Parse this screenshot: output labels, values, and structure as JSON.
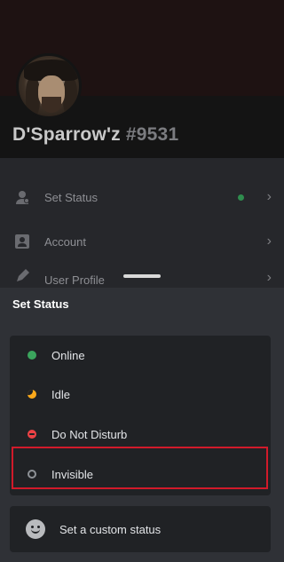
{
  "profile": {
    "name": "D'Sparrow'z",
    "tag": "#9531"
  },
  "settings": {
    "items": [
      {
        "label": "Set Status",
        "icon": "user-status-icon"
      },
      {
        "label": "Account",
        "icon": "account-icon"
      },
      {
        "label": "User Profile",
        "icon": "pencil-icon"
      }
    ]
  },
  "sheet": {
    "title": "Set Status",
    "statuses": [
      {
        "label": "Online",
        "icon": "online-dot-icon",
        "color": "#3ba55d"
      },
      {
        "label": "Idle",
        "icon": "idle-moon-icon",
        "color": "#faa81a"
      },
      {
        "label": "Do Not Disturb",
        "icon": "dnd-icon",
        "color": "#ed4245"
      },
      {
        "label": "Invisible",
        "icon": "invisible-ring-icon",
        "color": "#8e9297"
      }
    ],
    "highlighted": "Invisible",
    "custom_status_label": "Set a custom status"
  },
  "colors": {
    "highlight_border": "#d11a2a",
    "sheet_bg": "#2f3136",
    "card_bg": "#202225"
  }
}
